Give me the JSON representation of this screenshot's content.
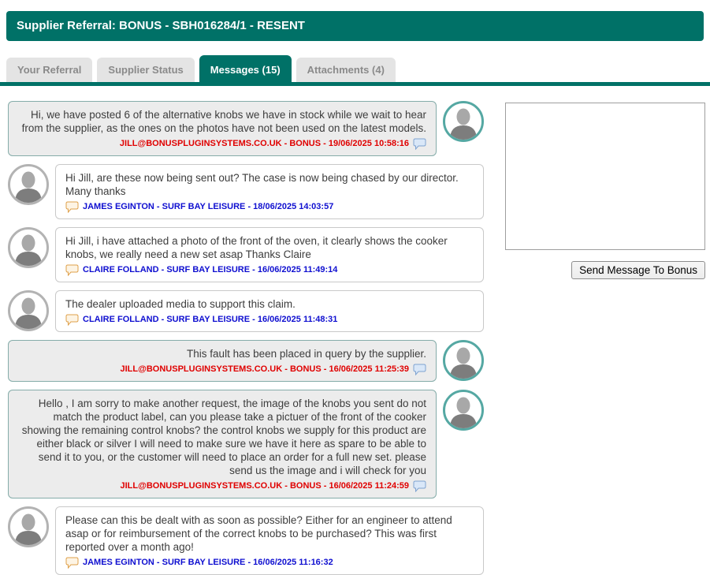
{
  "header": {
    "title": "Supplier Referral: BONUS - SBH016284/1 - RESENT"
  },
  "tabs": [
    {
      "label": "Your Referral",
      "active": false
    },
    {
      "label": "Supplier Status",
      "active": false
    },
    {
      "label": "Messages (15)",
      "active": true
    },
    {
      "label": "Attachments (4)",
      "active": false
    }
  ],
  "messages": [
    {
      "side": "right",
      "sender_type": "supplier",
      "text": "Hi, we have posted 6 of the alternative knobs we have in stock while we wait to hear from the supplier, as the ones on the photos have not been used on the latest models.",
      "footer": "JILL@BONUSPLUGINSYSTEMS.CO.UK - BONUS - 19/06/2025 10:58:16"
    },
    {
      "side": "left",
      "sender_type": "dealer",
      "text": "Hi Jill, are these now being sent out? The case is now being chased by our director. Many thanks",
      "footer": "JAMES EGINTON - SURF BAY LEISURE - 18/06/2025 14:03:57"
    },
    {
      "side": "left",
      "sender_type": "dealer",
      "text": "Hi Jill, i have attached a photo of the front of the oven, it clearly shows the cooker knobs, we really need a new set asap Thanks Claire",
      "footer": "CLAIRE FOLLAND - SURF BAY LEISURE - 16/06/2025 11:49:14"
    },
    {
      "side": "left",
      "sender_type": "dealer",
      "text": "The dealer uploaded media to support this claim.",
      "footer": "CLAIRE FOLLAND - SURF BAY LEISURE - 16/06/2025 11:48:31"
    },
    {
      "side": "right",
      "sender_type": "supplier",
      "text": "This fault has been placed in query by the supplier.",
      "footer": "JILL@BONUSPLUGINSYSTEMS.CO.UK - BONUS - 16/06/2025 11:25:39"
    },
    {
      "side": "right",
      "sender_type": "supplier",
      "text": "Hello , I am sorry to make another request, the image of the knobs you sent do not match the product label, can you please take a pictuer of the front of the cooker showing the remaining control knobs? the control knobs we supply for this product are either black or silver I will need to make sure we have it here as spare to be able to send it to you, or the customer will need to place an order for a full new set. please send us the image and i will check for you",
      "footer": "JILL@BONUSPLUGINSYSTEMS.CO.UK - BONUS - 16/06/2025 11:24:59"
    },
    {
      "side": "left",
      "sender_type": "dealer",
      "text": "Please can this be dealt with as soon as possible? Either for an engineer to attend asap or for reimbursement of the correct knobs to be purchased? This was first reported over a month ago!",
      "footer": "JAMES EGINTON - SURF BAY LEISURE - 16/06/2025 11:16:32"
    }
  ],
  "compose": {
    "textarea_value": "",
    "send_button_label": "Send Message To Bonus"
  },
  "colors": {
    "teal": "#007167",
    "red": "#e00000",
    "blue": "#0f0fd0"
  }
}
